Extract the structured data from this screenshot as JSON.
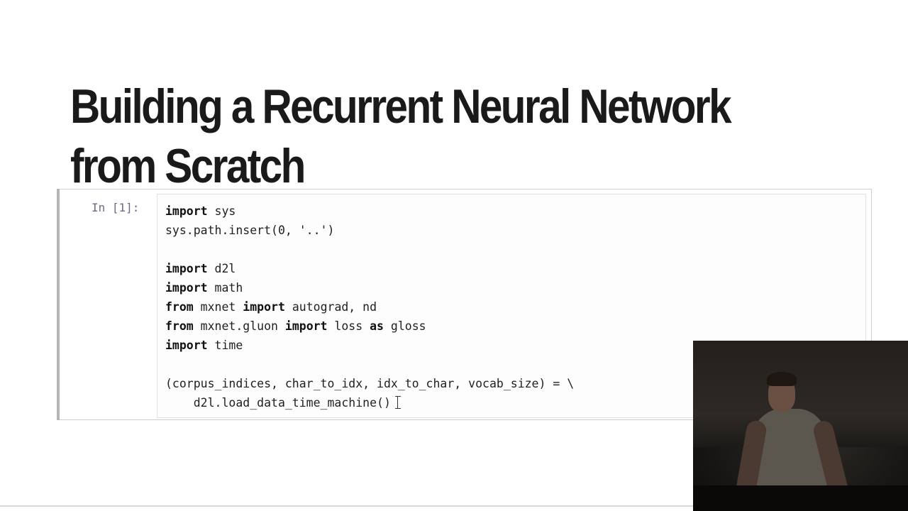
{
  "slide": {
    "title": "Building a Recurrent Neural Network from Scratch"
  },
  "cell": {
    "prompt": "In [1]:",
    "lines": [
      [
        {
          "t": "import",
          "kw": true
        },
        {
          "t": " sys"
        }
      ],
      [
        {
          "t": "sys.path.insert(0, '..')"
        }
      ],
      [],
      [
        {
          "t": "import",
          "kw": true
        },
        {
          "t": " d2l"
        }
      ],
      [
        {
          "t": "import",
          "kw": true
        },
        {
          "t": " math"
        }
      ],
      [
        {
          "t": "from",
          "kw": true
        },
        {
          "t": " mxnet "
        },
        {
          "t": "import",
          "kw": true
        },
        {
          "t": " autograd, nd"
        }
      ],
      [
        {
          "t": "from",
          "kw": true
        },
        {
          "t": " mxnet.gluon "
        },
        {
          "t": "import",
          "kw": true
        },
        {
          "t": " loss "
        },
        {
          "t": "as",
          "kw": true
        },
        {
          "t": " gloss"
        }
      ],
      [
        {
          "t": "import",
          "kw": true
        },
        {
          "t": " time"
        }
      ],
      [],
      [
        {
          "t": "(corpus_indices, char_to_idx, idx_to_char, vocab_size) = \\"
        }
      ],
      [
        {
          "t": "    d2l.load_data_time_machine()"
        }
      ]
    ]
  },
  "icons": {
    "text_cursor": "i-beam-cursor-icon"
  },
  "colors": {
    "background": "#ffffff",
    "title": "#1a1a1a",
    "cell_border": "#cfcfcf",
    "prompt": "#6a6a8a"
  }
}
